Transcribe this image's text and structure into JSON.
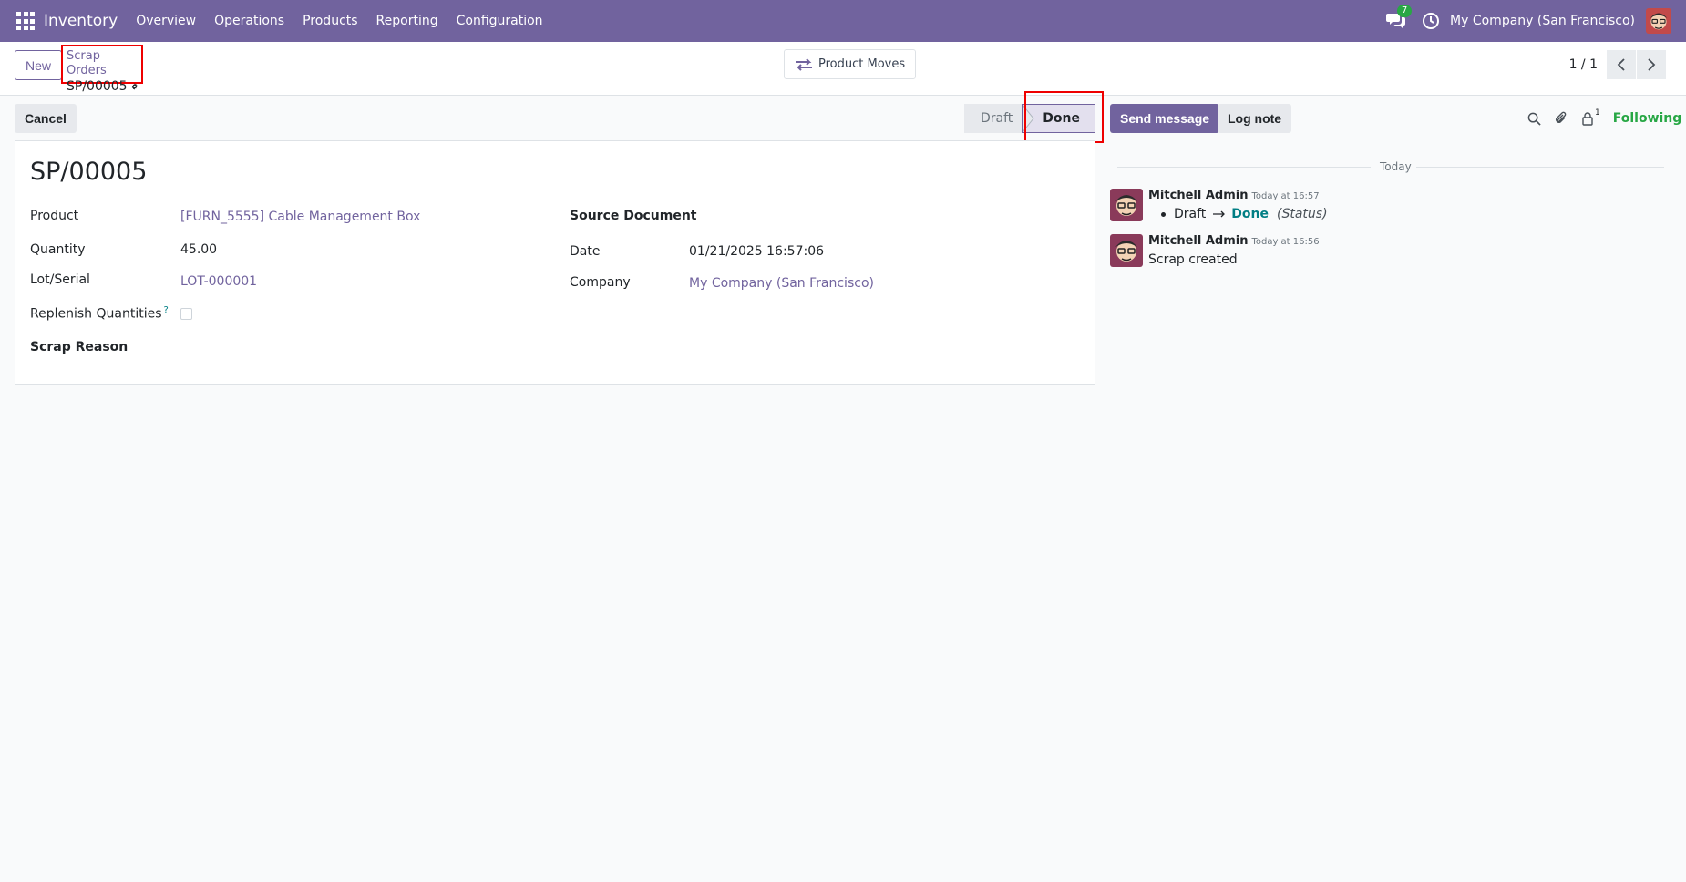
{
  "navbar": {
    "app_name": "Inventory",
    "menu": [
      "Overview",
      "Operations",
      "Products",
      "Reporting",
      "Configuration"
    ],
    "chat_count": "7",
    "company": "My Company (San Francisco)"
  },
  "control_panel": {
    "new_label": "New",
    "breadcrumb_parent": "Scrap Orders",
    "breadcrumb_current": "SP/00005",
    "product_moves_label": "Product Moves",
    "pager_value": "1 / 1"
  },
  "statusbar": {
    "cancel_label": "Cancel",
    "stages": [
      "Draft",
      "Done"
    ],
    "current_stage": "Done"
  },
  "form": {
    "title": "SP/00005",
    "fields": {
      "product_label": "Product",
      "product_value": "[FURN_5555] Cable Management Box",
      "quantity_label": "Quantity",
      "quantity_value": "45.00",
      "lot_label": "Lot/Serial",
      "lot_value": "LOT-000001",
      "replenish_label": "Replenish Quantities",
      "replenish_help": "?",
      "scrap_reason_label": "Scrap Reason",
      "source_doc_label": "Source Document",
      "date_label": "Date",
      "date_value": "01/21/2025 16:57:06",
      "company_label": "Company",
      "company_value": "My Company (San Francisco)"
    }
  },
  "chatter": {
    "send_message_label": "Send message",
    "log_note_label": "Log note",
    "follower_count": "1",
    "following_label": "Following",
    "date_separator": "Today",
    "messages": [
      {
        "author": "Mitchell Admin",
        "time": "Today at 16:57",
        "old_value": "Draft",
        "new_value": "Done",
        "field": "(Status)"
      },
      {
        "author": "Mitchell Admin",
        "time": "Today at 16:56",
        "body": "Scrap created"
      }
    ]
  },
  "colors": {
    "brand": "#71639e",
    "highlight": "#ee0000",
    "following": "#28a745",
    "link_teal": "#017e84"
  }
}
